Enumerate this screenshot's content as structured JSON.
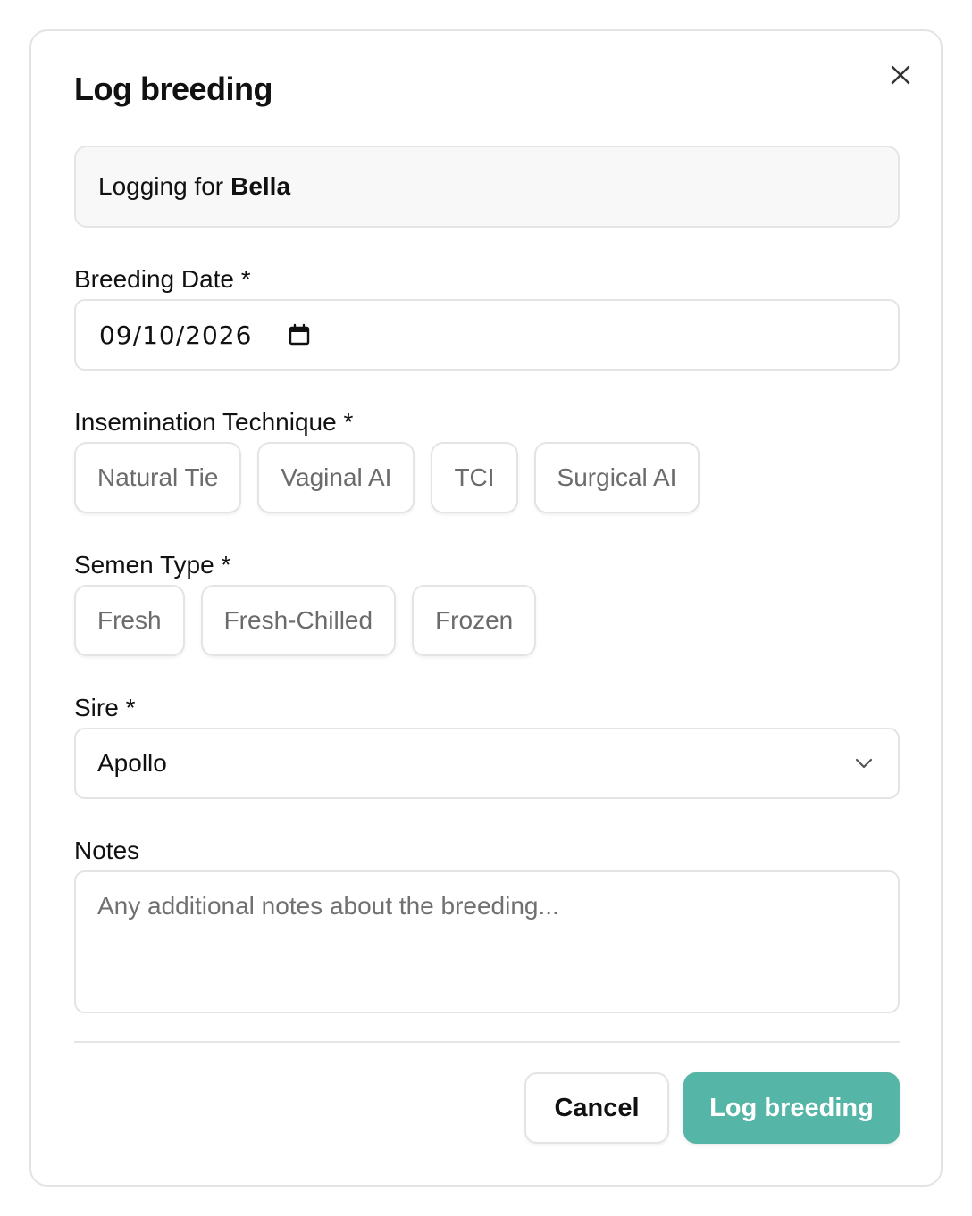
{
  "dialog": {
    "title": "Log breeding",
    "close_icon": "close-icon"
  },
  "info": {
    "prefix": "Logging for",
    "name": "Bella"
  },
  "breeding_date": {
    "label": "Breeding Date *",
    "value": "09/10/2026",
    "icon": "calendar-icon"
  },
  "technique": {
    "label": "Insemination Technique *",
    "options": [
      "Natural Tie",
      "Vaginal AI",
      "TCI",
      "Surgical AI"
    ]
  },
  "semen_type": {
    "label": "Semen Type *",
    "options": [
      "Fresh",
      "Fresh-Chilled",
      "Frozen"
    ]
  },
  "sire": {
    "label": "Sire *",
    "value": "Apollo",
    "icon": "chevron-down-icon"
  },
  "notes": {
    "label": "Notes",
    "placeholder": "Any additional notes about the breeding..."
  },
  "footer": {
    "cancel_label": "Cancel",
    "submit_label": "Log breeding"
  },
  "colors": {
    "accent": "#55b5a6",
    "border": "#e4e4e7",
    "muted_text": "#6b6b6b"
  }
}
